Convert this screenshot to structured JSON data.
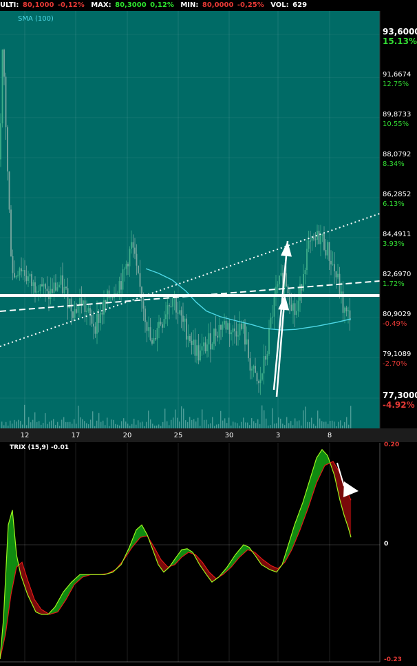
{
  "header": {
    "ulti_label": "ULTI:",
    "ulti_value": "80,1000",
    "ulti_pct": "-0,12%",
    "max_label": "MAX:",
    "max_value": "80,3000",
    "max_pct": "0,12%",
    "min_label": "MIN:",
    "min_value": "80,0000",
    "min_pct": "-0,25%",
    "vol_label": "VOL:",
    "vol_value": "629"
  },
  "colors": {
    "price_panel_bg": "#006b66",
    "trix_panel_bg": "#000000",
    "up_candle": "#3fae8a",
    "down_candle": "#7aa8a0",
    "sma": "#4dd8e6",
    "trix_line": "#9cf51e",
    "signal_line": "#e01818",
    "green_fill": "#118c11",
    "red_fill": "#7a0a0a"
  },
  "chart_data": [
    {
      "type": "candlestick",
      "indicator_label": "SMA (100)",
      "x_tick_labels": [
        "12",
        "17",
        "20",
        "25",
        "30",
        "3",
        "8"
      ],
      "y_axis": [
        {
          "value": "93,6000",
          "pct": "15.13%",
          "sign": "up",
          "bold": true
        },
        {
          "value": "91,6674",
          "pct": "12.75%",
          "sign": "up",
          "bold": false
        },
        {
          "value": "89,8733",
          "pct": "10.55%",
          "sign": "up",
          "bold": false
        },
        {
          "value": "88,0792",
          "pct": "8.34%",
          "sign": "up",
          "bold": false
        },
        {
          "value": "86,2852",
          "pct": "6.13%",
          "sign": "up",
          "bold": false
        },
        {
          "value": "84,4911",
          "pct": "3.93%",
          "sign": "up",
          "bold": false
        },
        {
          "value": "82,6970",
          "pct": "1.72%",
          "sign": "up",
          "bold": false
        },
        {
          "value": "80,9029",
          "pct": "-0.49%",
          "sign": "down",
          "bold": false
        },
        {
          "value": "79,1089",
          "pct": "-2.70%",
          "sign": "down",
          "bold": false
        },
        {
          "value": "77,3000",
          "pct": "-4.92%",
          "sign": "down",
          "bold": true
        }
      ],
      "ylim": [
        77.3,
        93.6
      ],
      "close_path": [
        [
          0,
          88.0
        ],
        [
          4,
          93.2
        ],
        [
          8,
          90.0
        ],
        [
          12,
          86.5
        ],
        [
          16,
          84.0
        ],
        [
          20,
          82.6
        ],
        [
          28,
          83.3
        ],
        [
          38,
          82.8
        ],
        [
          48,
          82.3
        ],
        [
          58,
          82.6
        ],
        [
          68,
          81.8
        ],
        [
          78,
          82.2
        ],
        [
          88,
          82.4
        ],
        [
          98,
          81.8
        ],
        [
          108,
          81.2
        ],
        [
          118,
          81.7
        ],
        [
          128,
          81.0
        ],
        [
          138,
          80.6
        ],
        [
          148,
          81.2
        ],
        [
          158,
          81.8
        ],
        [
          168,
          82.3
        ],
        [
          178,
          82.6
        ],
        [
          186,
          83.6
        ],
        [
          192,
          84.2
        ],
        [
          200,
          82.6
        ],
        [
          208,
          81.6
        ],
        [
          216,
          80.2
        ],
        [
          222,
          79.4
        ],
        [
          228,
          80.6
        ],
        [
          236,
          80.8
        ],
        [
          244,
          81.6
        ],
        [
          252,
          81.9
        ],
        [
          258,
          81.2
        ],
        [
          266,
          80.6
        ],
        [
          274,
          80.2
        ],
        [
          282,
          79.6
        ],
        [
          290,
          79.2
        ],
        [
          298,
          79.6
        ],
        [
          306,
          79.9
        ],
        [
          314,
          80.3
        ],
        [
          322,
          80.6
        ],
        [
          330,
          80.6
        ],
        [
          338,
          80.2
        ],
        [
          346,
          80.5
        ],
        [
          354,
          80.3
        ],
        [
          362,
          79.0
        ],
        [
          370,
          78.2
        ],
        [
          376,
          77.8
        ],
        [
          382,
          78.6
        ],
        [
          388,
          79.4
        ],
        [
          394,
          80.8
        ],
        [
          400,
          81.9
        ],
        [
          408,
          82.5
        ],
        [
          414,
          82.8
        ],
        [
          422,
          81.8
        ],
        [
          430,
          81.0
        ],
        [
          436,
          82.0
        ],
        [
          442,
          83.3
        ],
        [
          448,
          84.0
        ],
        [
          456,
          84.2
        ],
        [
          464,
          84.6
        ],
        [
          472,
          84.2
        ],
        [
          480,
          83.6
        ],
        [
          486,
          83.0
        ],
        [
          492,
          82.4
        ],
        [
          498,
          81.4
        ],
        [
          504,
          80.9
        ],
        [
          510,
          81.1
        ]
      ],
      "sma_path": [
        [
          212,
          83.1
        ],
        [
          230,
          82.9
        ],
        [
          250,
          82.6
        ],
        [
          270,
          82.1
        ],
        [
          285,
          81.6
        ],
        [
          300,
          81.2
        ],
        [
          320,
          80.95
        ],
        [
          345,
          80.75
        ],
        [
          365,
          80.6
        ],
        [
          385,
          80.42
        ],
        [
          410,
          80.35
        ],
        [
          430,
          80.38
        ],
        [
          460,
          80.52
        ],
        [
          490,
          80.7
        ],
        [
          510,
          80.85
        ]
      ],
      "horizontal_line": 81.9,
      "annotations": [
        "dotted-trendline",
        "dashed-trendline",
        "support-line",
        "arrow-up-1",
        "arrow-up-2"
      ]
    },
    {
      "type": "line",
      "indicator_label": "TRIX (15,9) -0.01",
      "y_axis": [
        {
          "value": "0.20",
          "sign": "down"
        },
        {
          "value": "0",
          "sign": "neutral"
        },
        {
          "value": "-0.23",
          "sign": "down"
        }
      ],
      "ylim": [
        -0.23,
        0.2
      ],
      "series": [
        {
          "role": "trix",
          "values": [
            [
              0,
              -0.23
            ],
            [
              5,
              -0.15
            ],
            [
              12,
              0.04
            ],
            [
              18,
              0.07
            ],
            [
              24,
              -0.02
            ],
            [
              30,
              -0.06
            ],
            [
              40,
              -0.1
            ],
            [
              52,
              -0.135
            ],
            [
              60,
              -0.14
            ],
            [
              70,
              -0.14
            ],
            [
              80,
              -0.125
            ],
            [
              92,
              -0.095
            ],
            [
              104,
              -0.075
            ],
            [
              116,
              -0.06
            ],
            [
              128,
              -0.06
            ],
            [
              140,
              -0.06
            ],
            [
              152,
              -0.06
            ],
            [
              164,
              -0.055
            ],
            [
              176,
              -0.04
            ],
            [
              188,
              -0.005
            ],
            [
              198,
              0.03
            ],
            [
              206,
              0.04
            ],
            [
              214,
              0.02
            ],
            [
              222,
              -0.01
            ],
            [
              230,
              -0.04
            ],
            [
              238,
              -0.055
            ],
            [
              246,
              -0.045
            ],
            [
              256,
              -0.025
            ],
            [
              264,
              -0.01
            ],
            [
              272,
              -0.008
            ],
            [
              280,
              -0.015
            ],
            [
              290,
              -0.04
            ],
            [
              300,
              -0.06
            ],
            [
              308,
              -0.075
            ],
            [
              318,
              -0.065
            ],
            [
              330,
              -0.045
            ],
            [
              342,
              -0.02
            ],
            [
              354,
              0.0
            ],
            [
              362,
              -0.005
            ],
            [
              370,
              -0.02
            ],
            [
              380,
              -0.04
            ],
            [
              392,
              -0.05
            ],
            [
              402,
              -0.055
            ],
            [
              410,
              -0.04
            ],
            [
              418,
              -0.005
            ],
            [
              428,
              0.04
            ],
            [
              440,
              0.085
            ],
            [
              450,
              0.13
            ],
            [
              460,
              0.175
            ],
            [
              468,
              0.192
            ],
            [
              476,
              0.18
            ],
            [
              486,
              0.14
            ],
            [
              494,
              0.09
            ],
            [
              500,
              0.06
            ],
            [
              506,
              0.035
            ],
            [
              510,
              0.015
            ]
          ]
        },
        {
          "role": "signal",
          "values": [
            [
              0,
              -0.23
            ],
            [
              8,
              -0.18
            ],
            [
              16,
              -0.1
            ],
            [
              24,
              -0.045
            ],
            [
              32,
              -0.035
            ],
            [
              40,
              -0.07
            ],
            [
              50,
              -0.11
            ],
            [
              60,
              -0.13
            ],
            [
              72,
              -0.14
            ],
            [
              84,
              -0.135
            ],
            [
              96,
              -0.11
            ],
            [
              108,
              -0.08
            ],
            [
              120,
              -0.065
            ],
            [
              132,
              -0.06
            ],
            [
              144,
              -0.06
            ],
            [
              156,
              -0.058
            ],
            [
              168,
              -0.05
            ],
            [
              180,
              -0.03
            ],
            [
              192,
              -0.005
            ],
            [
              204,
              0.015
            ],
            [
              214,
              0.018
            ],
            [
              224,
              -0.005
            ],
            [
              234,
              -0.03
            ],
            [
              244,
              -0.045
            ],
            [
              254,
              -0.04
            ],
            [
              264,
              -0.025
            ],
            [
              274,
              -0.015
            ],
            [
              284,
              -0.02
            ],
            [
              294,
              -0.035
            ],
            [
              304,
              -0.055
            ],
            [
              314,
              -0.068
            ],
            [
              324,
              -0.06
            ],
            [
              336,
              -0.045
            ],
            [
              348,
              -0.025
            ],
            [
              360,
              -0.01
            ],
            [
              370,
              -0.015
            ],
            [
              382,
              -0.03
            ],
            [
              394,
              -0.042
            ],
            [
              404,
              -0.048
            ],
            [
              414,
              -0.035
            ],
            [
              424,
              -0.01
            ],
            [
              436,
              0.03
            ],
            [
              448,
              0.075
            ],
            [
              460,
              0.125
            ],
            [
              472,
              0.16
            ],
            [
              484,
              0.168
            ],
            [
              494,
              0.145
            ],
            [
              502,
              0.115
            ],
            [
              510,
              0.09
            ]
          ]
        }
      ]
    }
  ]
}
